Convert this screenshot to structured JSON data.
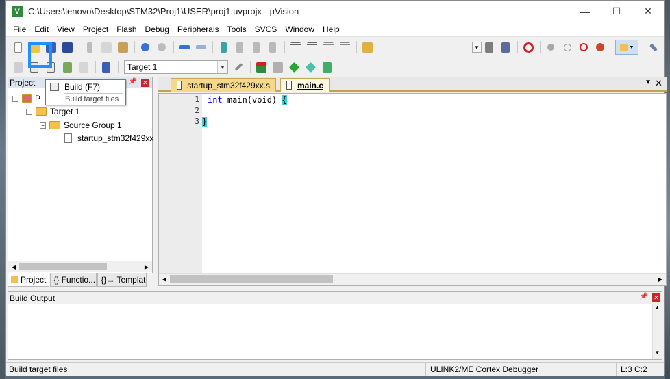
{
  "window": {
    "title": "C:\\Users\\lenovo\\Desktop\\STM32\\Proj1\\USER\\proj1.uvprojx - µVision",
    "app_icon": "V"
  },
  "window_controls": {
    "minimize": "—",
    "maximize": "☐",
    "close": "✕"
  },
  "menu": [
    "File",
    "Edit",
    "View",
    "Project",
    "Flash",
    "Debug",
    "Peripherals",
    "Tools",
    "SVCS",
    "Window",
    "Help"
  ],
  "toolbar2": {
    "target": "Target 1"
  },
  "tooltip": {
    "title": "Build (F7)",
    "subtitle": "Build target files"
  },
  "project_panel": {
    "title": "Project",
    "tree": {
      "root_label": "P",
      "target": "Target 1",
      "group": "Source Group 1",
      "file": "startup_stm32f429xx"
    },
    "tabs": [
      "Project",
      "{} Functio...",
      "{}→ Templat..."
    ]
  },
  "editor": {
    "tabs": [
      "startup_stm32f429xx.s",
      "main.c"
    ],
    "lines": [
      {
        "num": "1",
        "kw": "int",
        "rest": " main(void) ",
        "brace": "{"
      },
      {
        "num": "2",
        "kw": "",
        "rest": "",
        "brace": ""
      },
      {
        "num": "3",
        "kw": "",
        "rest": "",
        "brace": "}"
      }
    ]
  },
  "build_output": {
    "title": "Build Output"
  },
  "status": {
    "left": "Build target files",
    "debugger": "ULINK2/ME Cortex Debugger",
    "position": "L:3 C:2"
  },
  "colors": {
    "highlight": "#1e90ff",
    "brace_match": "#3fd0d6",
    "keyword": "#0000ff",
    "tab_active": "#f4d98a"
  }
}
